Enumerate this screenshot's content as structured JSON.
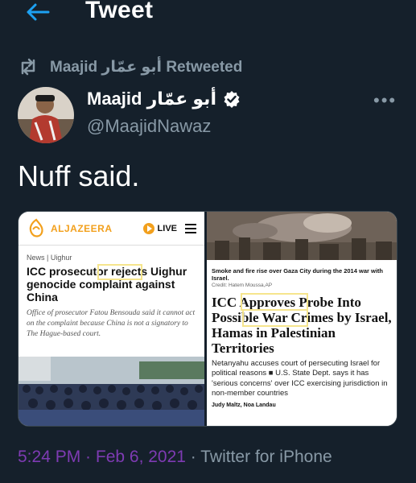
{
  "header": {
    "title": "Tweet"
  },
  "retweet": {
    "label": "Maajid أبو عمّار Retweeted"
  },
  "author": {
    "name": "Maajid أبو عمّار",
    "handle": "@MaajidNawaz"
  },
  "tweet": {
    "text": "Nuff said."
  },
  "media_left": {
    "brand": "ALJAZEERA",
    "live": "LIVE",
    "category": "News  |  Uighur",
    "headline": "ICC prosecutor rejects Uighur genocide complaint against China",
    "subtitle": "Office of prosecutor Fatou Bensouda said it cannot act on the complaint because China is not a signatory to The Hague-based court."
  },
  "media_right": {
    "caption": "Smoke and fire rise over Gaza City during the 2014 war with Israel.",
    "credit": "Credit: Hatem Moussa,AP",
    "headline": "ICC Approves Probe Into Possible War Crimes by Israel, Hamas in Palestinian Territories",
    "body": "Netanyahu accuses court of persecuting Israel for political reasons ■ U.S. State Dept. says it has 'serious concerns' over ICC exercising jurisdiction in non-member countries",
    "byline": "Judy Maltz, Noa Landau"
  },
  "meta": {
    "time": "5:24 PM · Feb 6, 2021",
    "separator": " · ",
    "source": "Twitter for iPhone"
  },
  "colors": {
    "background": "#15202b",
    "accent": "#1da1f2",
    "muted": "#8899a6",
    "time": "#7e3bb3"
  }
}
